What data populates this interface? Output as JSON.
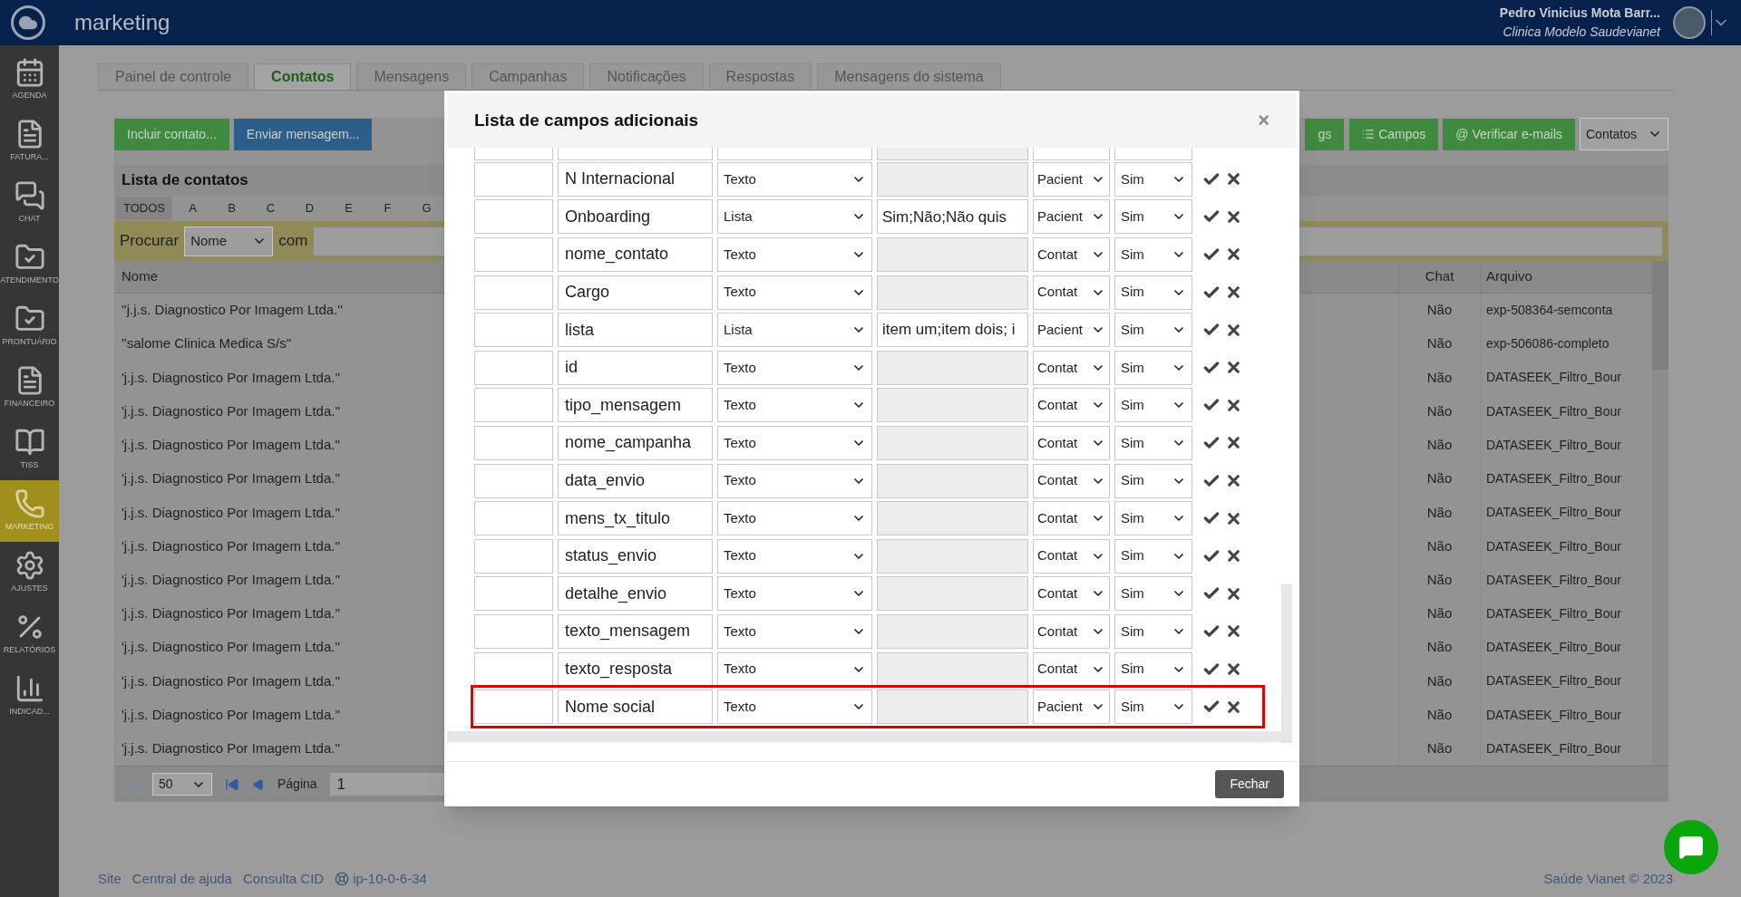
{
  "header": {
    "module": "marketing",
    "user_name": "Pedro Vinicius Mota Barr...",
    "clinic": "Clinica Modelo Saudevianet"
  },
  "sidebar": {
    "items": [
      {
        "label": "AGENDA",
        "kind": "calendar",
        "selected": false
      },
      {
        "label": "FATURA...",
        "kind": "invoice",
        "selected": false
      },
      {
        "label": "CHAT",
        "kind": "chat",
        "selected": false
      },
      {
        "label": "ATENDIMENTO",
        "kind": "folder",
        "selected": false
      },
      {
        "label": "PRONTUÁRIO",
        "kind": "folder",
        "selected": false
      },
      {
        "label": "FINANCEIRO",
        "kind": "invoice",
        "selected": false
      },
      {
        "label": "TISS",
        "kind": "book",
        "selected": false
      },
      {
        "label": "MARKETING",
        "kind": "phone",
        "selected": true
      },
      {
        "label": "AJUSTES",
        "kind": "gears",
        "selected": false
      },
      {
        "label": "RELATÓRIOS",
        "kind": "percent",
        "selected": false
      },
      {
        "label": "INDICAD...",
        "kind": "bars",
        "selected": false
      }
    ]
  },
  "tabs": [
    {
      "label": "Painel de controle",
      "selected": false
    },
    {
      "label": "Contatos",
      "selected": true
    },
    {
      "label": "Mensagens",
      "selected": false
    },
    {
      "label": "Campanhas",
      "selected": false
    },
    {
      "label": "Notificações",
      "selected": false
    },
    {
      "label": "Respostas",
      "selected": false
    },
    {
      "label": "Mensagens do sistema",
      "selected": false
    }
  ],
  "toolbar": {
    "left_buttons": [
      {
        "label": "Incluir contato...",
        "color": "#3f8a3f"
      },
      {
        "label": "Enviar mensagem...",
        "color": "#2d5d8a"
      }
    ],
    "right_buttons": [
      {
        "label": "gs",
        "kind": "plain"
      },
      {
        "label": "Campos",
        "kind": "list"
      },
      {
        "label": "@ Verificar e-mails",
        "kind": "plain"
      }
    ],
    "view_select": "Contatos"
  },
  "contacts": {
    "title": "Lista de contatos",
    "letters": [
      {
        "label": "TODOS",
        "selected": true
      },
      {
        "label": "A",
        "selected": false
      },
      {
        "label": "B",
        "selected": false
      },
      {
        "label": "C",
        "selected": false
      },
      {
        "label": "D",
        "selected": false
      },
      {
        "label": "E",
        "selected": false
      },
      {
        "label": "F",
        "selected": false
      },
      {
        "label": "G",
        "selected": false
      }
    ],
    "search": {
      "label": "Procurar",
      "field": "Nome",
      "connector": "com"
    },
    "columns": [
      "Nome",
      "Chat",
      "Arquivo"
    ],
    "rows": [
      {
        "name": "''j.j.s. Diagnostico Por Imagem Ltda.''",
        "chat": "Não",
        "file": "exp-508364-semconta"
      },
      {
        "name": "''salome Clinica Medica S/s''",
        "chat": "Não",
        "file": "exp-506086-completo"
      },
      {
        "name": "'j.j.s. Diagnostico Por Imagem Ltda.''",
        "chat": "Não",
        "file": "DATASEEK_Filtro_Bour"
      },
      {
        "name": "'j.j.s. Diagnostico Por Imagem Ltda.''",
        "chat": "Não",
        "file": "DATASEEK_Filtro_Bour"
      },
      {
        "name": "'j.j.s. Diagnostico Por Imagem Ltda.''",
        "chat": "Não",
        "file": "DATASEEK_Filtro_Bour"
      },
      {
        "name": "'j.j.s. Diagnostico Por Imagem Ltda.''",
        "chat": "Não",
        "file": "DATASEEK_Filtro_Bour"
      },
      {
        "name": "'j.j.s. Diagnostico Por Imagem Ltda.''",
        "chat": "Não",
        "file": "DATASEEK_Filtro_Bour"
      },
      {
        "name": "'j.j.s. Diagnostico Por Imagem Ltda.''",
        "chat": "Não",
        "file": "DATASEEK_Filtro_Bour"
      },
      {
        "name": "'j.j.s. Diagnostico Por Imagem Ltda.''",
        "chat": "Não",
        "file": "DATASEEK_Filtro_Bour"
      },
      {
        "name": "'j.j.s. Diagnostico Por Imagem Ltda.''",
        "chat": "Não",
        "file": "DATASEEK_Filtro_Bour"
      },
      {
        "name": "'j.j.s. Diagnostico Por Imagem Ltda.''",
        "chat": "Não",
        "file": "DATASEEK_Filtro_Bour"
      },
      {
        "name": "'j.j.s. Diagnostico Por Imagem Ltda.''",
        "chat": "Não",
        "file": "DATASEEK_Filtro_Bour"
      },
      {
        "name": "'j.j.s. Diagnostico Por Imagem Ltda.''",
        "chat": "Não",
        "file": "DATASEEK_Filtro_Bour"
      },
      {
        "name": "'j.j.s. Diagnostico Por Imagem Ltda.''",
        "chat": "Não",
        "file": "DATASEEK_Filtro_Bour"
      }
    ],
    "pager": {
      "page_size": "50",
      "page_label": "Página",
      "page": "1"
    }
  },
  "modal": {
    "title": "Lista de campos adicionais",
    "close": "×",
    "rows": [
      {
        "name": "N Internacional",
        "type": "Texto",
        "options": "",
        "options_disabled": true,
        "owner": "Pacient",
        "required": "Sim",
        "highlighted": false
      },
      {
        "name": "Onboarding",
        "type": "Lista",
        "options": "Sim;Não;Não quis",
        "options_disabled": false,
        "owner": "Pacient",
        "required": "Sim",
        "highlighted": false
      },
      {
        "name": "nome_contato",
        "type": "Texto",
        "options": "",
        "options_disabled": true,
        "owner": "Contat",
        "required": "Sim",
        "highlighted": false
      },
      {
        "name": "Cargo",
        "type": "Texto",
        "options": "",
        "options_disabled": true,
        "owner": "Contat",
        "required": "Sim",
        "highlighted": false
      },
      {
        "name": "lista",
        "type": "Lista",
        "options": "item um;item dois; i",
        "options_disabled": false,
        "owner": "Pacient",
        "required": "Sim",
        "highlighted": false
      },
      {
        "name": "id",
        "type": "Texto",
        "options": "",
        "options_disabled": true,
        "owner": "Contat",
        "required": "Sim",
        "highlighted": false
      },
      {
        "name": "tipo_mensagem",
        "type": "Texto",
        "options": "",
        "options_disabled": true,
        "owner": "Contat",
        "required": "Sim",
        "highlighted": false
      },
      {
        "name": "nome_campanha",
        "type": "Texto",
        "options": "",
        "options_disabled": true,
        "owner": "Contat",
        "required": "Sim",
        "highlighted": false
      },
      {
        "name": "data_envio",
        "type": "Texto",
        "options": "",
        "options_disabled": true,
        "owner": "Contat",
        "required": "Sim",
        "highlighted": false
      },
      {
        "name": "mens_tx_titulo",
        "type": "Texto",
        "options": "",
        "options_disabled": true,
        "owner": "Contat",
        "required": "Sim",
        "highlighted": false
      },
      {
        "name": "status_envio",
        "type": "Texto",
        "options": "",
        "options_disabled": true,
        "owner": "Contat",
        "required": "Sim",
        "highlighted": false
      },
      {
        "name": "detalhe_envio",
        "type": "Texto",
        "options": "",
        "options_disabled": true,
        "owner": "Contat",
        "required": "Sim",
        "highlighted": false
      },
      {
        "name": "texto_mensagem",
        "type": "Texto",
        "options": "",
        "options_disabled": true,
        "owner": "Contat",
        "required": "Sim",
        "highlighted": false
      },
      {
        "name": "texto_resposta",
        "type": "Texto",
        "options": "",
        "options_disabled": true,
        "owner": "Contat",
        "required": "Sim",
        "highlighted": false
      },
      {
        "name": "Nome social",
        "type": "Texto",
        "options": "",
        "options_disabled": true,
        "owner": "Pacient",
        "required": "Sim",
        "highlighted": true
      }
    ],
    "footer_button": "Fechar"
  },
  "footer": {
    "links": [
      "Site",
      "Central de ajuda",
      "Consulta CID"
    ],
    "server": "ip-10-0-6-34",
    "copyright": "Saúde Vianet © 2023"
  }
}
